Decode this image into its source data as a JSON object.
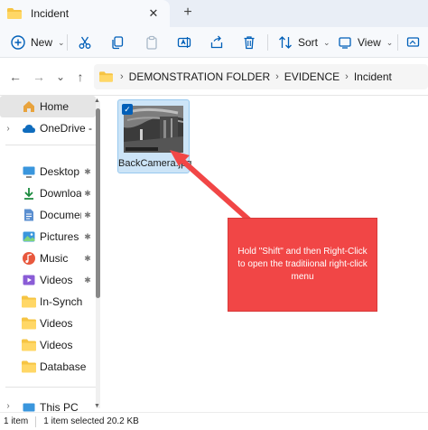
{
  "window": {
    "tab_title": "Incident",
    "tab_close": "✕",
    "new_tab": "+"
  },
  "toolbar": {
    "new_label": "New",
    "new_chevron": "⌄",
    "sort_label": "Sort",
    "sort_chevron": "⌄",
    "view_label": "View",
    "view_chevron": "⌄",
    "accent_color": "#005fb8"
  },
  "navigation": {
    "back": "←",
    "forward": "→",
    "recent": "⌄",
    "up": "↑"
  },
  "address": {
    "crumbs": [
      "DEMONSTRATION FOLDER",
      "EVIDENCE",
      "Incident"
    ],
    "separator": "›"
  },
  "sidebar": {
    "items": [
      {
        "label": "Home",
        "icon": "home-icon"
      },
      {
        "label": "OneDrive - Perso",
        "icon": "cloud-icon"
      },
      {
        "label": "Desktop",
        "icon": "desktop-icon"
      },
      {
        "label": "Downloads",
        "icon": "download-icon"
      },
      {
        "label": "Documents",
        "icon": "documents-icon"
      },
      {
        "label": "Pictures",
        "icon": "pictures-icon"
      },
      {
        "label": "Music",
        "icon": "music-icon"
      },
      {
        "label": "Videos",
        "icon": "videos-icon"
      },
      {
        "label": "In-Synch",
        "icon": "folder-icon"
      },
      {
        "label": "Videos",
        "icon": "folder-icon"
      },
      {
        "label": "Videos",
        "icon": "folder-icon"
      },
      {
        "label": "Database",
        "icon": "folder-icon"
      },
      {
        "label": "This PC",
        "icon": "pc-icon"
      }
    ],
    "pin_glyph": "📌"
  },
  "content": {
    "file": {
      "name": "BackCamera.jpg",
      "selected": true
    }
  },
  "callout": {
    "text": "Hold \"Shift\" and then Right-Click to open the traditiional right-click menu",
    "color": "#f14646"
  },
  "status": {
    "items_count": "1 item",
    "selected_info": "1 item selected  20.2 KB"
  }
}
